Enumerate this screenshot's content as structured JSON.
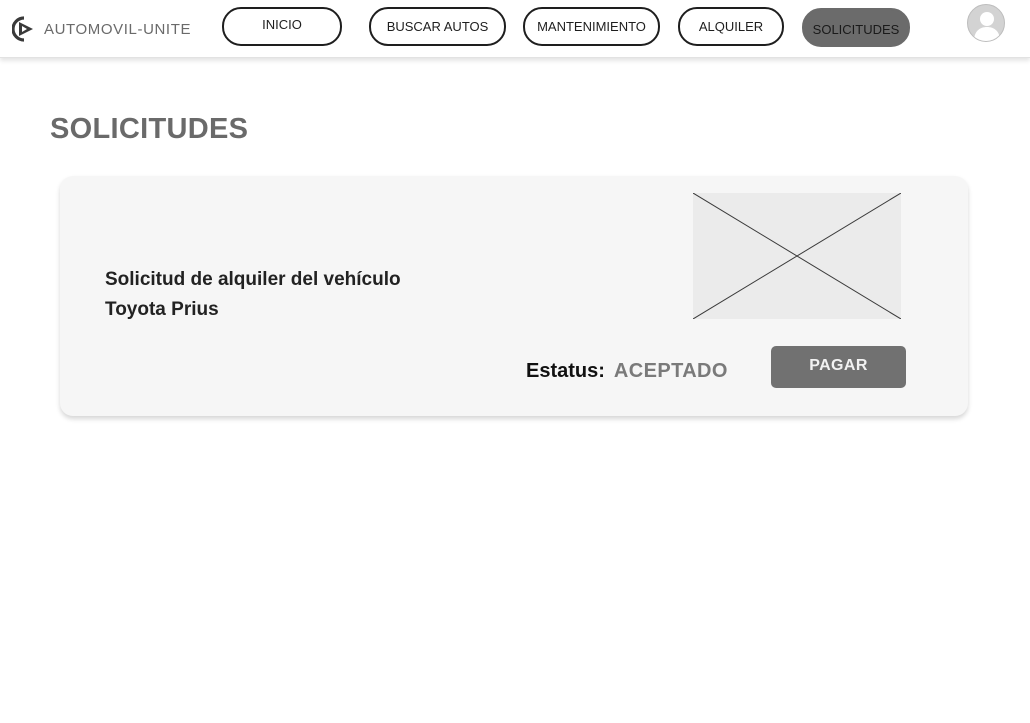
{
  "header": {
    "brand": "AUTOMOVIL-UNITE",
    "nav": [
      {
        "label": "INICIO",
        "active": false
      },
      {
        "label": "BUSCAR AUTOS",
        "active": false
      },
      {
        "label": "MANTENIMIENTO",
        "active": false
      },
      {
        "label": "ALQUILER",
        "active": false
      },
      {
        "label": "SOLICITUDES",
        "active": true
      }
    ],
    "avatar_icon": "user-avatar-icon"
  },
  "main": {
    "title": "SOLICITUDES",
    "requests": [
      {
        "title": "Solicitud de alquiler del vehículo Toyota Prius",
        "image_icon": "image-placeholder-icon",
        "status_label": "Estatus:",
        "status_value": "ACEPTADO",
        "action_label": "PAGAR"
      }
    ]
  },
  "colors": {
    "active_nav": "#6b6b6b",
    "pay_button": "#717171",
    "card_background": "#f6f6f6",
    "title_gray": "#6a6a6a"
  }
}
